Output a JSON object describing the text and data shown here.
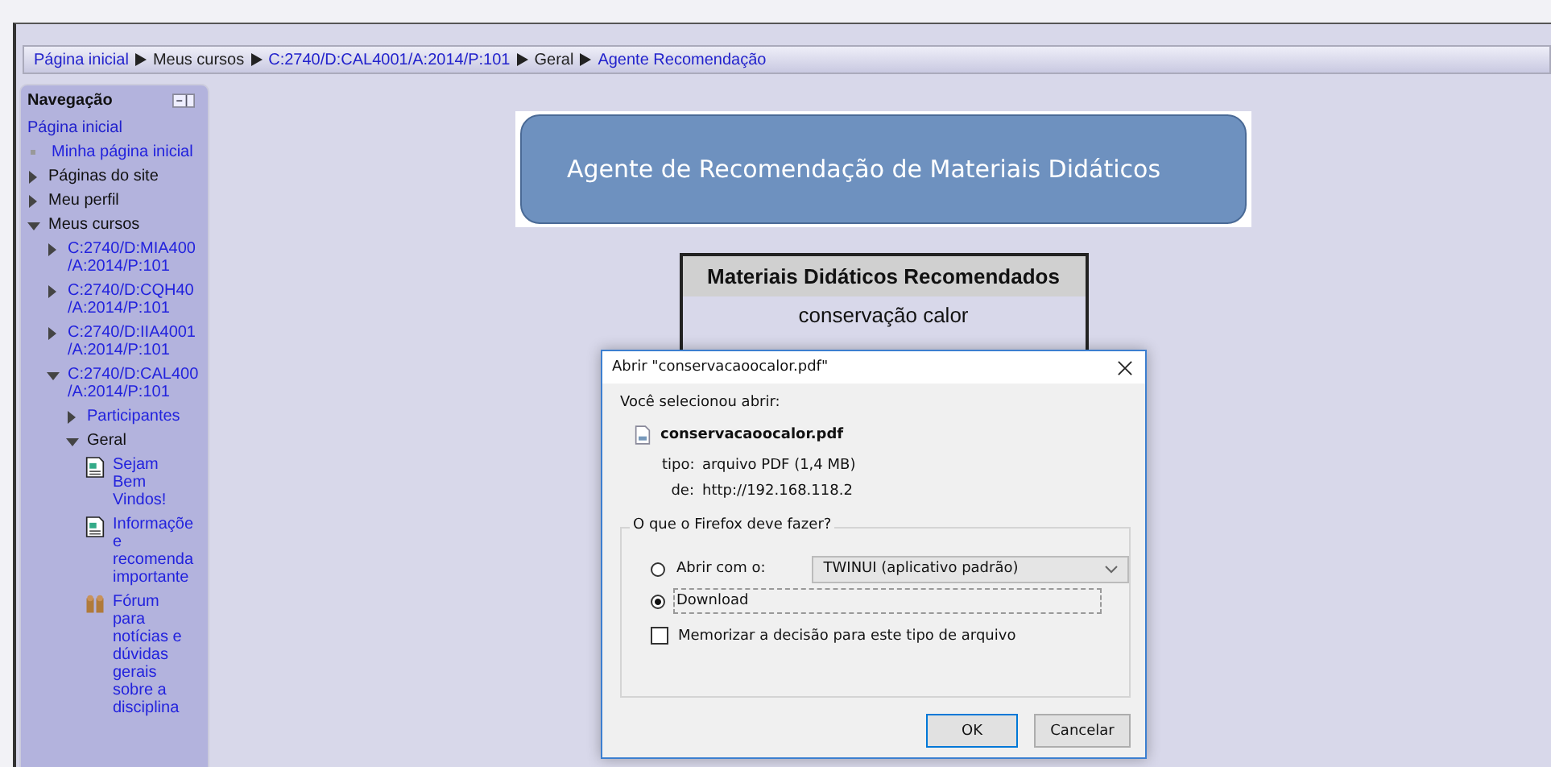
{
  "breadcrumb": [
    {
      "label": "Página inicial",
      "link": true
    },
    {
      "label": "Meus cursos",
      "link": false
    },
    {
      "label": "C:2740/D:CAL4001/A:2014/P:101",
      "link": true
    },
    {
      "label": "Geral",
      "link": false
    },
    {
      "label": "Agente Recomendação",
      "link": true
    }
  ],
  "navigation": {
    "title": "Navegação",
    "home": "Página inicial",
    "items": [
      {
        "kind": "leaf",
        "lines": [
          "Minha página inicial"
        ],
        "link": true
      },
      {
        "kind": "branch",
        "lines": [
          "Páginas do site"
        ],
        "link": false,
        "expanded": false
      },
      {
        "kind": "branch",
        "lines": [
          "Meu perfil"
        ],
        "link": false,
        "expanded": false
      },
      {
        "kind": "branch",
        "lines": [
          "Meus cursos"
        ],
        "link": false,
        "expanded": true,
        "children": [
          {
            "kind": "branch",
            "lines": [
              "C:2740/D:MIA400",
              "/A:2014/P:101"
            ],
            "link": true,
            "expanded": false
          },
          {
            "kind": "branch",
            "lines": [
              "C:2740/D:CQH40",
              "/A:2014/P:101"
            ],
            "link": true,
            "expanded": false
          },
          {
            "kind": "branch",
            "lines": [
              "C:2740/D:IIA4001",
              "/A:2014/P:101"
            ],
            "link": true,
            "expanded": false
          },
          {
            "kind": "branch",
            "lines": [
              "C:2740/D:CAL400",
              "/A:2014/P:101"
            ],
            "link": true,
            "expanded": true,
            "children": [
              {
                "kind": "branch",
                "lines": [
                  "Participantes"
                ],
                "link": true,
                "expanded": false
              },
              {
                "kind": "branch",
                "lines": [
                  "Geral"
                ],
                "link": false,
                "expanded": true,
                "children": [
                  {
                    "kind": "page",
                    "lines": [
                      "Sejam",
                      "Bem",
                      "Vindos!"
                    ],
                    "link": true
                  },
                  {
                    "kind": "page",
                    "lines": [
                      "Informaçõe",
                      "e",
                      "recomenda",
                      "importante"
                    ],
                    "link": true
                  },
                  {
                    "kind": "forum",
                    "lines": [
                      "Fórum",
                      "para",
                      "notícias e",
                      "dúvidas",
                      "gerais",
                      "sobre a",
                      "disciplina"
                    ],
                    "link": true
                  }
                ]
              }
            ]
          }
        ]
      }
    ]
  },
  "banner": {
    "title": "Agente de Recomendação de Materiais Didáticos"
  },
  "table": {
    "heading": "Materiais Didáticos Recomendados",
    "rows": [
      "conservação calor"
    ]
  },
  "dialog": {
    "title": "Abrir \"conservacaoocalor.pdf\"",
    "intro": "Você selecionou abrir:",
    "file_name": "conservacaoocalor.pdf",
    "type_label": "tipo:",
    "type_value": "arquivo PDF (1,4 MB)",
    "from_label": "de:",
    "from_value": "http://192.168.118.2",
    "group_title": "O que o Firefox deve fazer?",
    "options": [
      {
        "label": "Abrir com o:",
        "selected": false,
        "app": "TWINUI (aplicativo padrão)"
      },
      {
        "label": "Download",
        "selected": true
      }
    ],
    "remember": {
      "label": "Memorizar a decisão para este tipo de arquivo",
      "checked": false
    },
    "buttons": [
      {
        "label": "OK",
        "default": true
      },
      {
        "label": "Cancelar",
        "default": false
      }
    ]
  }
}
